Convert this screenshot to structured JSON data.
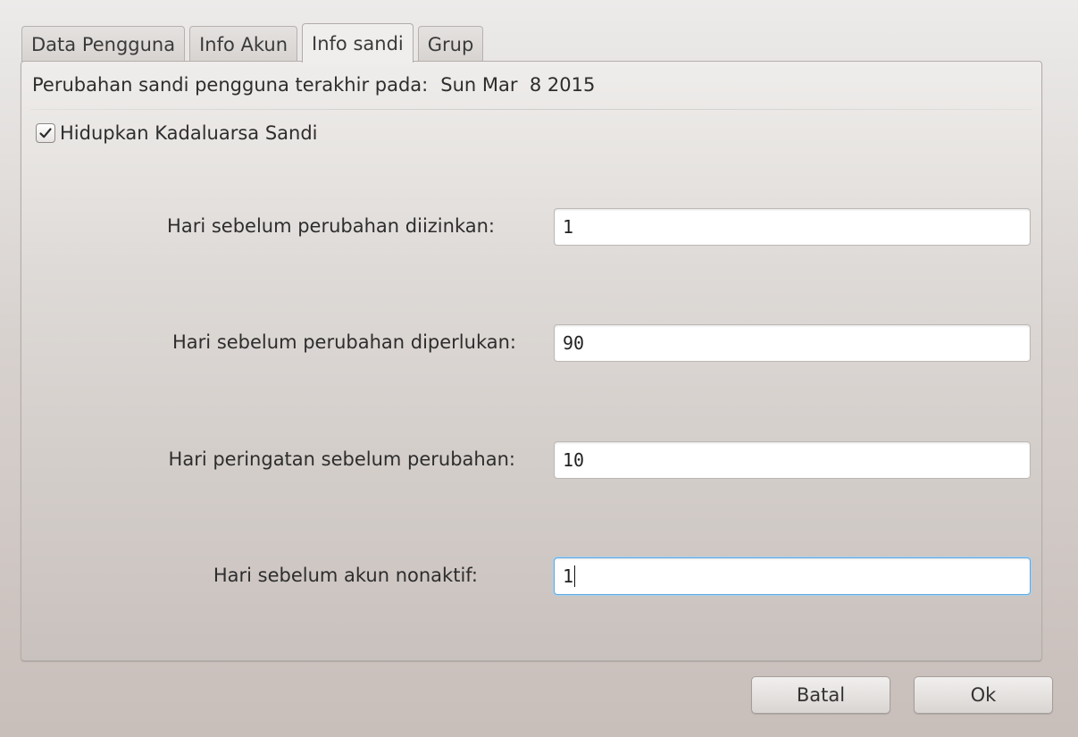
{
  "tabs": [
    {
      "label": "Data Pengguna",
      "active": false
    },
    {
      "label": "Info Akun",
      "active": false
    },
    {
      "label": "Info sandi",
      "active": true
    },
    {
      "label": "Grup",
      "active": false
    }
  ],
  "password_info": {
    "last_change_label": "Perubahan sandi pengguna terakhir pada:",
    "last_change_value": "Sun Mar  8 2015",
    "expiry_checkbox": {
      "label": "Hidupkan Kadaluarsa Sandi",
      "checked": true
    },
    "fields": [
      {
        "label": "Hari sebelum perubahan diizinkan:",
        "value": "1"
      },
      {
        "label": "Hari sebelum perubahan diperlukan:",
        "value": "90"
      },
      {
        "label": "Hari peringatan sebelum perubahan:",
        "value": "10"
      },
      {
        "label": "Hari sebelum akun nonaktif:",
        "value": "1"
      }
    ]
  },
  "buttons": {
    "cancel": "Batal",
    "ok": "Ok"
  },
  "icons": {
    "checkbox_check": "checkmark-icon"
  },
  "colors": {
    "focus_border": "#5fa9e0"
  }
}
